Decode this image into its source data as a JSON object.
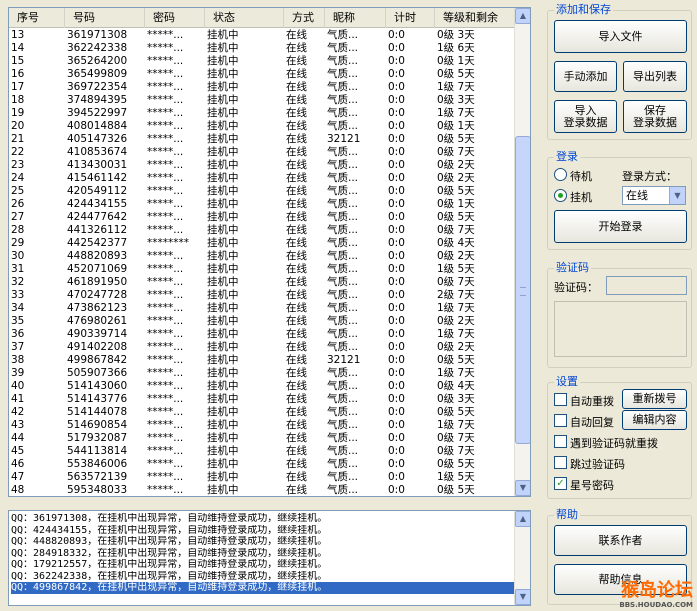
{
  "list": {
    "columns": [
      "序号",
      "号码",
      "密码",
      "状态",
      "方式",
      "昵称",
      "计时",
      "等级和剩余"
    ],
    "rows": [
      [
        "13",
        "361971308",
        "*****...",
        "挂机中",
        "在线",
        "气质...",
        "0:0",
        "0级 3天"
      ],
      [
        "14",
        "362242338",
        "*****...",
        "挂机中",
        "在线",
        "气质...",
        "0:0",
        "1级 6天"
      ],
      [
        "15",
        "365264200",
        "*****...",
        "挂机中",
        "在线",
        "气质...",
        "0:0",
        "0级 1天"
      ],
      [
        "16",
        "365499809",
        "*****...",
        "挂机中",
        "在线",
        "气质...",
        "0:0",
        "0级 5天"
      ],
      [
        "17",
        "369722354",
        "*****...",
        "挂机中",
        "在线",
        "气质...",
        "0:0",
        "1级 7天"
      ],
      [
        "18",
        "374894395",
        "*****...",
        "挂机中",
        "在线",
        "气质...",
        "0:0",
        "0级 3天"
      ],
      [
        "19",
        "394522997",
        "*****...",
        "挂机中",
        "在线",
        "气质...",
        "0:0",
        "1级 7天"
      ],
      [
        "20",
        "408014884",
        "*****...",
        "挂机中",
        "在线",
        "气质...",
        "0:0",
        "0级 1天"
      ],
      [
        "21",
        "405147326",
        "*****...",
        "挂机中",
        "在线",
        "32121",
        "0:0",
        "0级 5天"
      ],
      [
        "22",
        "410853674",
        "*****...",
        "挂机中",
        "在线",
        "气质...",
        "0:0",
        "0级 7天"
      ],
      [
        "23",
        "413430031",
        "*****...",
        "挂机中",
        "在线",
        "气质...",
        "0:0",
        "0级 2天"
      ],
      [
        "24",
        "415461142",
        "*****...",
        "挂机中",
        "在线",
        "气质...",
        "0:0",
        "0级 2天"
      ],
      [
        "25",
        "420549112",
        "*****...",
        "挂机中",
        "在线",
        "气质...",
        "0:0",
        "0级 5天"
      ],
      [
        "26",
        "424434155",
        "*****...",
        "挂机中",
        "在线",
        "气质...",
        "0:0",
        "0级 1天"
      ],
      [
        "27",
        "424477642",
        "*****...",
        "挂机中",
        "在线",
        "气质...",
        "0:0",
        "0级 5天"
      ],
      [
        "28",
        "441326112",
        "*****...",
        "挂机中",
        "在线",
        "气质...",
        "0:0",
        "0级 7天"
      ],
      [
        "29",
        "442542377",
        "********",
        "挂机中",
        "在线",
        "气质...",
        "0:0",
        "0级 4天"
      ],
      [
        "30",
        "448820893",
        "*****...",
        "挂机中",
        "在线",
        "气质...",
        "0:0",
        "0级 2天"
      ],
      [
        "31",
        "452071069",
        "*****...",
        "挂机中",
        "在线",
        "气质...",
        "0:0",
        "1级 5天"
      ],
      [
        "32",
        "461891950",
        "*****...",
        "挂机中",
        "在线",
        "气质...",
        "0:0",
        "0级 7天"
      ],
      [
        "33",
        "470247728",
        "*****...",
        "挂机中",
        "在线",
        "气质...",
        "0:0",
        "2级 7天"
      ],
      [
        "34",
        "473862123",
        "*****...",
        "挂机中",
        "在线",
        "气质...",
        "0:0",
        "1级 7天"
      ],
      [
        "35",
        "476980261",
        "*****...",
        "挂机中",
        "在线",
        "气质...",
        "0:0",
        "0级 2天"
      ],
      [
        "36",
        "490339714",
        "*****...",
        "挂机中",
        "在线",
        "气质...",
        "0:0",
        "1级 7天"
      ],
      [
        "37",
        "491402208",
        "*****...",
        "挂机中",
        "在线",
        "气质...",
        "0:0",
        "0级 2天"
      ],
      [
        "38",
        "499867842",
        "*****...",
        "挂机中",
        "在线",
        "32121",
        "0:0",
        "0级 5天"
      ],
      [
        "39",
        "505907366",
        "*****...",
        "挂机中",
        "在线",
        "气质...",
        "0:0",
        "1级 7天"
      ],
      [
        "40",
        "514143060",
        "*****...",
        "挂机中",
        "在线",
        "气质...",
        "0:0",
        "0级 4天"
      ],
      [
        "41",
        "514143776",
        "*****...",
        "挂机中",
        "在线",
        "气质...",
        "0:0",
        "0级 3天"
      ],
      [
        "42",
        "514144078",
        "*****...",
        "挂机中",
        "在线",
        "气质...",
        "0:0",
        "0级 5天"
      ],
      [
        "43",
        "514690854",
        "*****...",
        "挂机中",
        "在线",
        "气质...",
        "0:0",
        "1级 7天"
      ],
      [
        "44",
        "517932087",
        "*****...",
        "挂机中",
        "在线",
        "气质...",
        "0:0",
        "0级 7天"
      ],
      [
        "45",
        "544113814",
        "*****...",
        "挂机中",
        "在线",
        "气质...",
        "0:0",
        "0级 7天"
      ],
      [
        "46",
        "553846006",
        "*****...",
        "挂机中",
        "在线",
        "气质...",
        "0:0",
        "0级 5天"
      ],
      [
        "47",
        "563572139",
        "*****...",
        "挂机中",
        "在线",
        "气质...",
        "0:0",
        "1级 5天"
      ],
      [
        "48",
        "595348033",
        "*****...",
        "挂机中",
        "在线",
        "气质...",
        "0:0",
        "0级 5天"
      ]
    ]
  },
  "log": {
    "lines": [
      "QQ：361971308，在挂机中出现异常，自动维持登录成功，继续挂机。",
      "QQ：424434155，在挂机中出现异常，自动维持登录成功，继续挂机。",
      "QQ：448820893，在挂机中出现异常，自动维持登录成功，继续挂机。",
      "QQ：284918332，在挂机中出现异常，自动维持登录成功，继续挂机。",
      "QQ：179212557，在挂机中出现异常，自动维持登录成功，继续挂机。",
      "QQ：362242338，在挂机中出现异常，自动维持登录成功，继续挂机。",
      "QQ：499867842，在挂机中出现异常，自动维持登录成功，继续挂机。"
    ],
    "selected_index": 6
  },
  "add_save": {
    "title": "添加和保存",
    "import_file": "导入文件",
    "manual_add": "手动添加",
    "export_list": "导出列表",
    "import_login_data": "导入\n登录数据",
    "save_login_data": "保存\n登录数据"
  },
  "login": {
    "title": "登录",
    "standby_label": "待机",
    "hangup_label": "挂机",
    "selected_mode": "挂机",
    "method_label": "登录方式：",
    "method_value": "在线",
    "start_button": "开始登录"
  },
  "captcha": {
    "title": "验证码",
    "label": "验证码：",
    "input_value": ""
  },
  "settings": {
    "title": "设置",
    "auto_redial": {
      "label": "自动重拨",
      "checked": false
    },
    "redial_button": "重新拨号",
    "auto_reply": {
      "label": "自动回复",
      "checked": false
    },
    "edit_content_button": "编辑内容",
    "captcha_redial": {
      "label": "遇到验证码就重拨",
      "checked": false
    },
    "skip_captcha": {
      "label": "跳过验证码",
      "checked": false
    },
    "star_password": {
      "label": "星号密码",
      "checked": true
    }
  },
  "help": {
    "title": "帮助",
    "contact_author": "联系作者",
    "help_info": "帮助信息"
  },
  "watermark": {
    "main": "猴岛论坛",
    "sub": "BBS.HOUDAO.COM"
  },
  "colors": {
    "window_bg": "#ece9d8",
    "group_title": "#0046d5",
    "selection": "#316ac5"
  }
}
